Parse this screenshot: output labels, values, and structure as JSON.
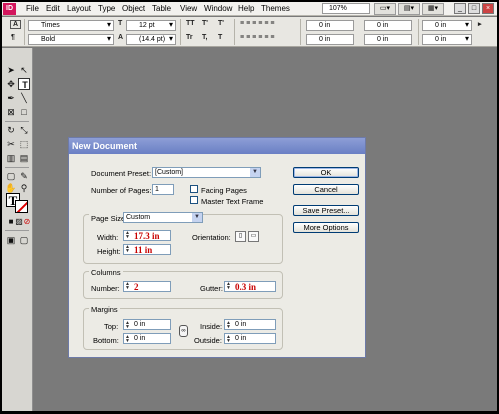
{
  "app_logo": "ID",
  "menu": [
    "File",
    "Edit",
    "Layout",
    "Type",
    "Object",
    "Table",
    "View",
    "Window",
    "Help",
    "Themes"
  ],
  "zoom": "107%",
  "control_bar": {
    "font_family": "Times",
    "font_style": "Bold",
    "font_size": "12 pt",
    "leading": "(14.4 pt)",
    "tt_buttons": [
      "TT",
      "T'",
      "T'",
      "Tr",
      "T,",
      "T"
    ],
    "fields": [
      "0 in",
      "0 in",
      "0 in",
      "0 in"
    ]
  },
  "dialog": {
    "title": "New Document",
    "document_preset_label": "Document Preset:",
    "document_preset_value": "[Custom]",
    "number_of_pages_label": "Number of Pages:",
    "number_of_pages_value": "1",
    "facing_pages_label": "Facing Pages",
    "master_text_frame_label": "Master Text Frame",
    "page_size_label": "Page Size:",
    "page_size_value": "Custom",
    "width_label": "Width:",
    "width_value": "17.3 in",
    "height_label": "Height:",
    "height_value": "11 in",
    "orientation_label": "Orientation:",
    "columns_group": "Columns",
    "number_label": "Number:",
    "number_value": "2",
    "gutter_label": "Gutter:",
    "gutter_value": "0.3 in",
    "margins_group": "Margins",
    "top_label": "Top:",
    "top_value": "0 in",
    "bottom_label": "Bottom:",
    "bottom_value": "0 in",
    "inside_label": "Inside:",
    "inside_value": "0 in",
    "outside_label": "Outside:",
    "outside_value": "0 in",
    "buttons": {
      "ok": "OK",
      "cancel": "Cancel",
      "save_preset": "Save Preset...",
      "more_options": "More Options"
    }
  },
  "colors": {
    "app_background": "#7a7a7a",
    "dialog_title_bar": "#6a7fc4",
    "highlight_text": "#c80000"
  }
}
